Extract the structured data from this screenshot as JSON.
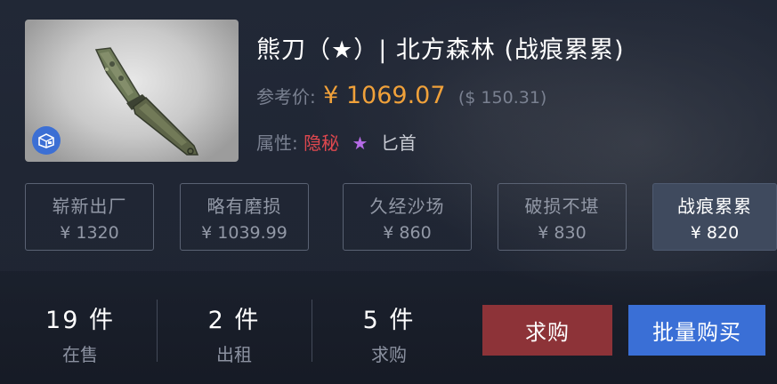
{
  "item": {
    "title": "熊刀（★）| 北方森林 (战痕累累)",
    "price_label": "参考价:",
    "price_cny": "¥ 1069.07",
    "price_usd": "($ 150.31)",
    "attr_label": "属性:",
    "rarity": "隐秘",
    "star": "★",
    "type": "匕首",
    "icons": {
      "thumbnail": "knife-image",
      "badge": "case-box-icon"
    }
  },
  "wear_options": [
    {
      "name": "崭新出厂",
      "price": "¥ 1320"
    },
    {
      "name": "略有磨损",
      "price": "¥ 1039.99"
    },
    {
      "name": "久经沙场",
      "price": "¥ 860"
    },
    {
      "name": "破损不堪",
      "price": "¥ 830"
    },
    {
      "name": "战痕累累",
      "price": "¥ 820",
      "selected": true
    }
  ],
  "stats": [
    {
      "count": "19 件",
      "label": "在售"
    },
    {
      "count": "2 件",
      "label": "出租"
    },
    {
      "count": "5 件",
      "label": "求购"
    }
  ],
  "buttons": {
    "buy_request": "求购",
    "bulk_buy": "批量购买"
  },
  "colors": {
    "price": "#f0a13a",
    "rarity": "#e0484f",
    "star": "#b56be6",
    "buy_request_bg": "#8d3338",
    "bulk_buy_bg": "#3a6fd6",
    "selected_wear_bg": "#3f4a5e"
  }
}
